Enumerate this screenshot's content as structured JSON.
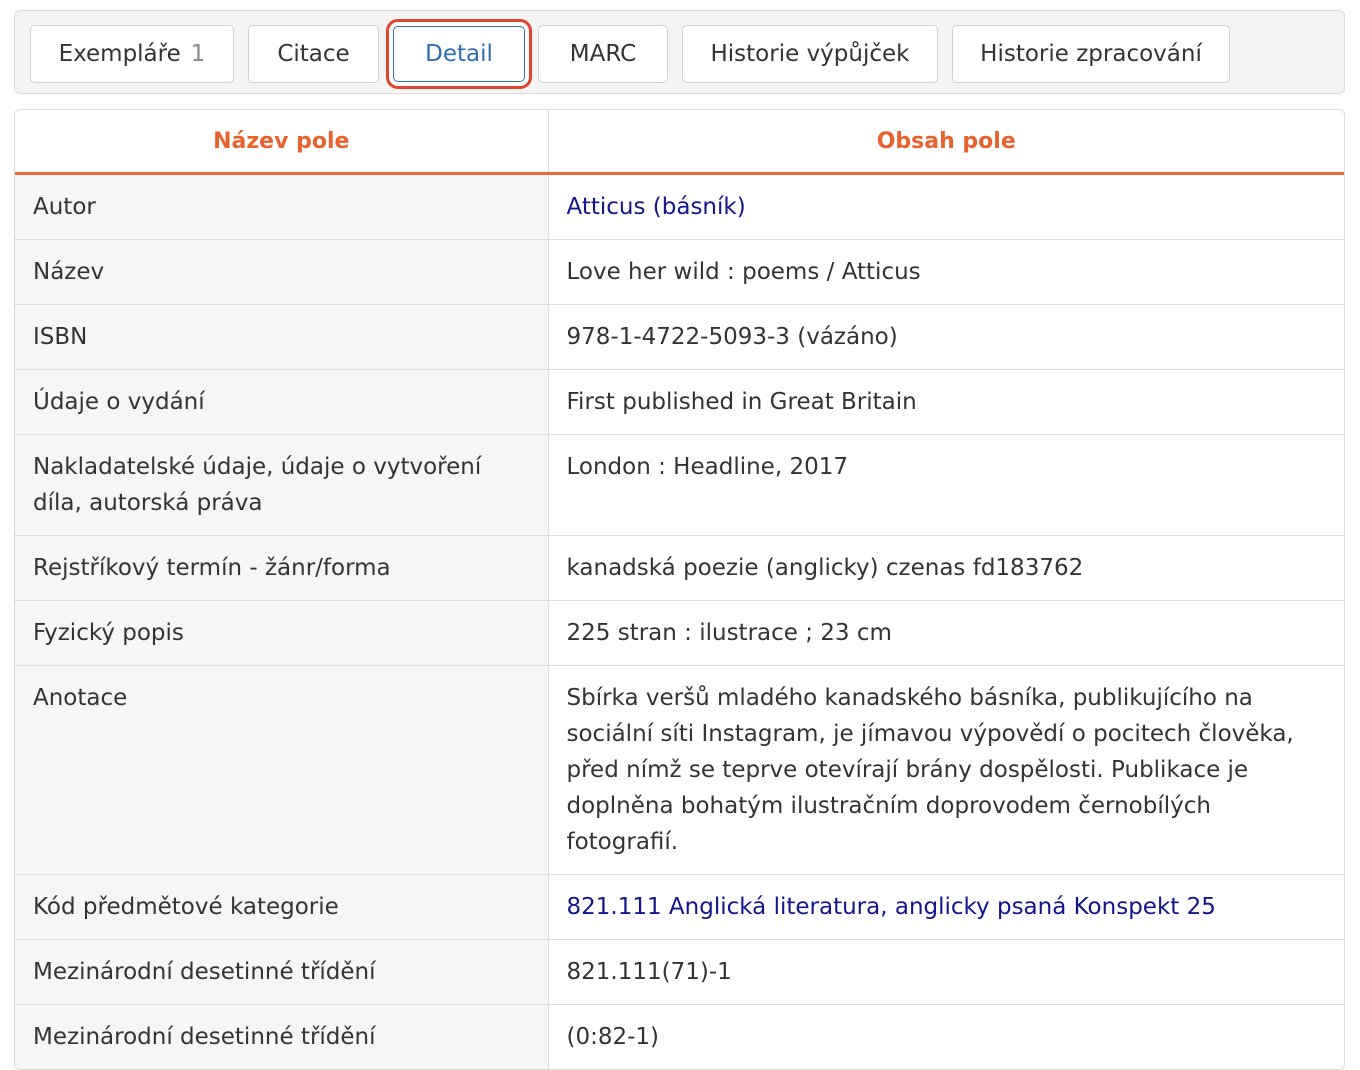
{
  "tabs": [
    {
      "label": "Exempláře",
      "count": "1",
      "active": false
    },
    {
      "label": "Citace",
      "active": false
    },
    {
      "label": "Detail",
      "active": true
    },
    {
      "label": "MARC",
      "active": false
    },
    {
      "label": "Historie výpůjček",
      "active": false
    },
    {
      "label": "Historie zpracování",
      "active": false
    }
  ],
  "table": {
    "headers": {
      "name": "Název pole",
      "value": "Obsah pole"
    },
    "rows": [
      {
        "name": "Autor",
        "value": "Atticus (básník)",
        "link": true
      },
      {
        "name": "Název",
        "value": "Love her wild : poems / Atticus",
        "link": false
      },
      {
        "name": "ISBN",
        "value": "978-1-4722-5093-3 (vázáno)",
        "link": false
      },
      {
        "name": "Údaje o vydání",
        "value": "First published in Great Britain",
        "link": false
      },
      {
        "name": "Nakladatelské údaje, údaje o vytvoření díla, autorská práva",
        "value": "London : Headline, 2017",
        "link": false
      },
      {
        "name": "Rejstříkový termín - žánr/forma",
        "value": "kanadská poezie (anglicky) czenas fd183762",
        "link": false
      },
      {
        "name": "Fyzický popis",
        "value": "225 stran : ilustrace ; 23 cm",
        "link": false
      },
      {
        "name": "Anotace",
        "value": "Sbírka veršů mladého kanadského básníka, publikujícího na sociální síti Instagram, je jímavou výpovědí o pocitech člověka, před nímž se teprve otevírají brány dospělosti. Publikace je doplněna bohatým ilustračním doprovodem černobílých fotografií.",
        "link": false
      },
      {
        "name": "Kód předmětové kategorie",
        "value": "821.111 Anglická literatura, anglicky psaná Konspekt 25",
        "link": true
      },
      {
        "name": "Mezinárodní desetinné třídění",
        "value": "821.111(71)-1",
        "link": false
      },
      {
        "name": "Mezinárodní desetinné třídění",
        "value": "(0:82-1)",
        "link": false
      }
    ]
  },
  "colors": {
    "accent_orange": "#e8632b",
    "active_tab_text": "#2f6db1",
    "highlight_red": "#e0442d",
    "link_blue": "#14148c"
  }
}
